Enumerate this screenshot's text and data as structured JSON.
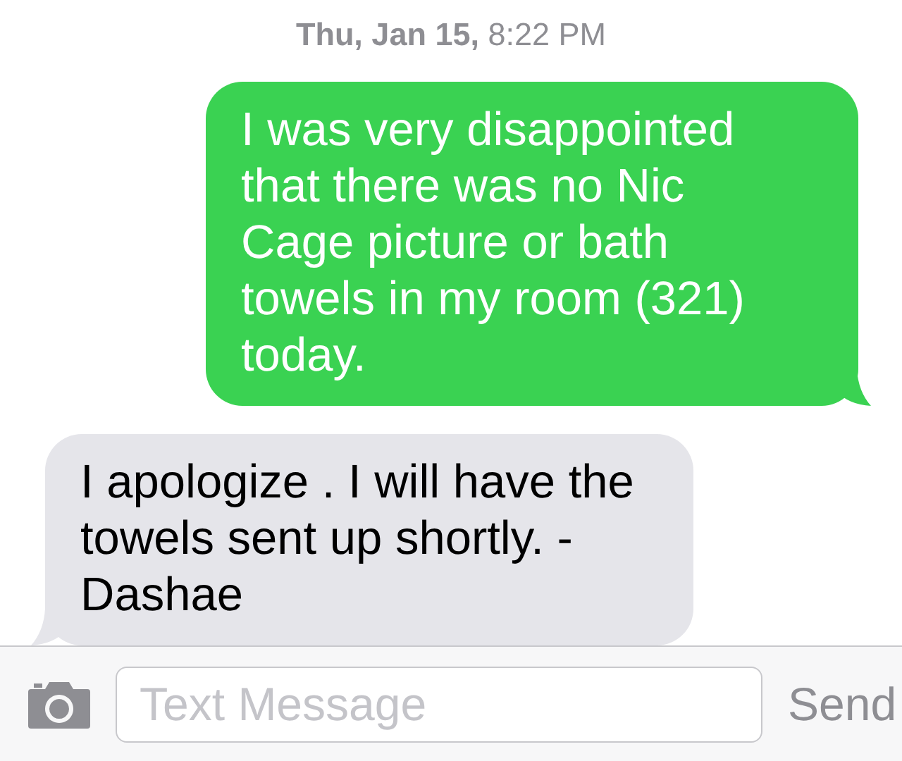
{
  "timestamp": "**Thu, Jan 15,** 8:22 PM",
  "messages": [
    {
      "kind": "outgoing",
      "text": "I was very disappointed that there was no Nic Cage picture or bath towels in my room (321) today."
    },
    {
      "kind": "incoming",
      "text": "I apologize . I will have the towels sent up shortly. -Dashae"
    }
  ],
  "composer": {
    "placeholder": "Text Message",
    "send": "Send"
  }
}
